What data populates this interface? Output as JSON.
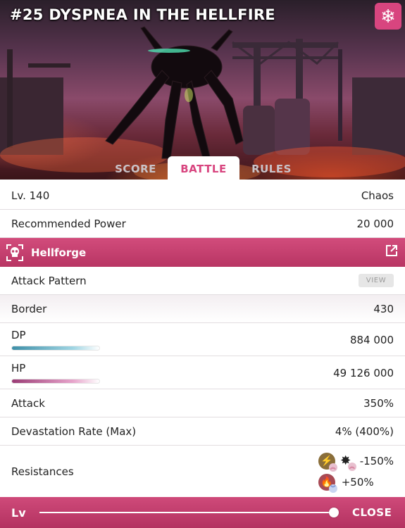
{
  "header": {
    "title": "#25 DYSPNEA IN THE HELLFIRE",
    "snow_icon": "snowflake-icon",
    "accent_color": "#d8457f"
  },
  "tabs": [
    {
      "label": "SCORE",
      "active": false
    },
    {
      "label": "BATTLE",
      "active": true
    },
    {
      "label": "RULES",
      "active": false
    }
  ],
  "details": {
    "level_label": "Lv. 140",
    "difficulty": "Chaos",
    "recommended_power_label": "Recommended Power",
    "recommended_power_value": "20 000"
  },
  "section": {
    "title": "Hellforge",
    "icon": "skull-icon",
    "link_icon": "external-link-icon"
  },
  "stats": {
    "attack_pattern_label": "Attack Pattern",
    "view_label": "VIEW",
    "border_label": "Border",
    "border_value": "430",
    "dp_label": "DP",
    "dp_value": "884 000",
    "dp_fill": 1.0,
    "hp_label": "HP",
    "hp_value": "49 126 000",
    "hp_fill": 1.0,
    "attack_label": "Attack",
    "attack_value": "350%",
    "devastation_label": "Devastation Rate (Max)",
    "devastation_value": "4% (400%)"
  },
  "resistances": {
    "label": "Resistances",
    "items": [
      {
        "icons": [
          "lightning-icon",
          "burst-icon"
        ],
        "value": "-150%"
      },
      {
        "icons": [
          "fire-icon"
        ],
        "value": "+50%"
      }
    ]
  },
  "footer": {
    "lv_label": "Lv",
    "slider_level": 1.0,
    "close_label": "CLOSE"
  }
}
